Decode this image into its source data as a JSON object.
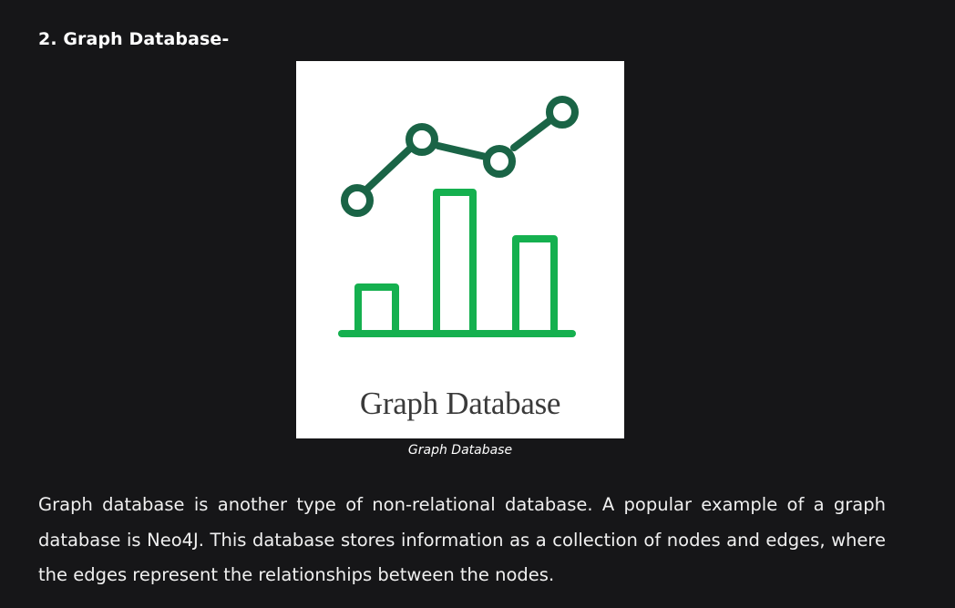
{
  "heading": "2. Graph Database-",
  "figure": {
    "image_text": "Graph Database",
    "caption": "Graph Database",
    "colors": {
      "line_and_nodes": "#1a6446",
      "bars": "#15b04f",
      "background": "#ffffff"
    },
    "icon": "graph-database-icon"
  },
  "paragraph": "Graph database is another type of non-relational database. A popular example of a graph database is Neo4J. This database stores information as a collection of nodes and edges, where the edges represent the relationships between the nodes."
}
